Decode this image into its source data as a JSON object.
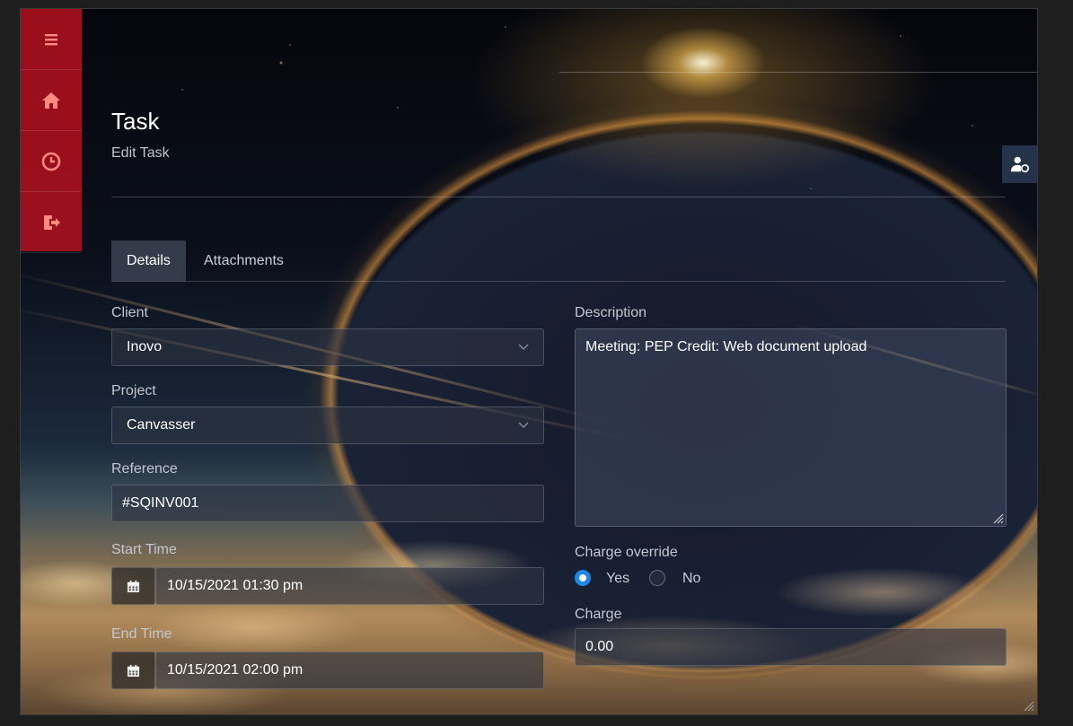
{
  "sidebar": {
    "items": [
      {
        "name": "menu",
        "icon": "menu-icon"
      },
      {
        "name": "home",
        "icon": "home-icon"
      },
      {
        "name": "history",
        "icon": "clock-icon"
      },
      {
        "name": "logout",
        "icon": "logout-icon"
      }
    ],
    "color": "#a8101e"
  },
  "header": {
    "title": "Task",
    "subtitle": "Edit Task"
  },
  "user_button": {
    "icon": "user-refresh-icon"
  },
  "tabs": [
    {
      "label": "Details",
      "active": true
    },
    {
      "label": "Attachments",
      "active": false
    }
  ],
  "form": {
    "client": {
      "label": "Client",
      "value": "Inovo"
    },
    "project": {
      "label": "Project",
      "value": "Canvasser"
    },
    "reference": {
      "label": "Reference",
      "value": "#SQINV001"
    },
    "start_time": {
      "label": "Start Time",
      "value": "10/15/2021 01:30 pm"
    },
    "end_time": {
      "label": "End Time",
      "value": "10/15/2021 02:00 pm"
    },
    "description": {
      "label": "Description",
      "value": "Meeting: PEP Credit:  Web document upload"
    },
    "charge_override": {
      "label": "Charge override",
      "options": [
        {
          "label": "Yes",
          "selected": true
        },
        {
          "label": "No",
          "selected": false
        }
      ]
    },
    "charge": {
      "label": "Charge",
      "value": "0.00"
    }
  },
  "accent_color": "#1e88e5"
}
